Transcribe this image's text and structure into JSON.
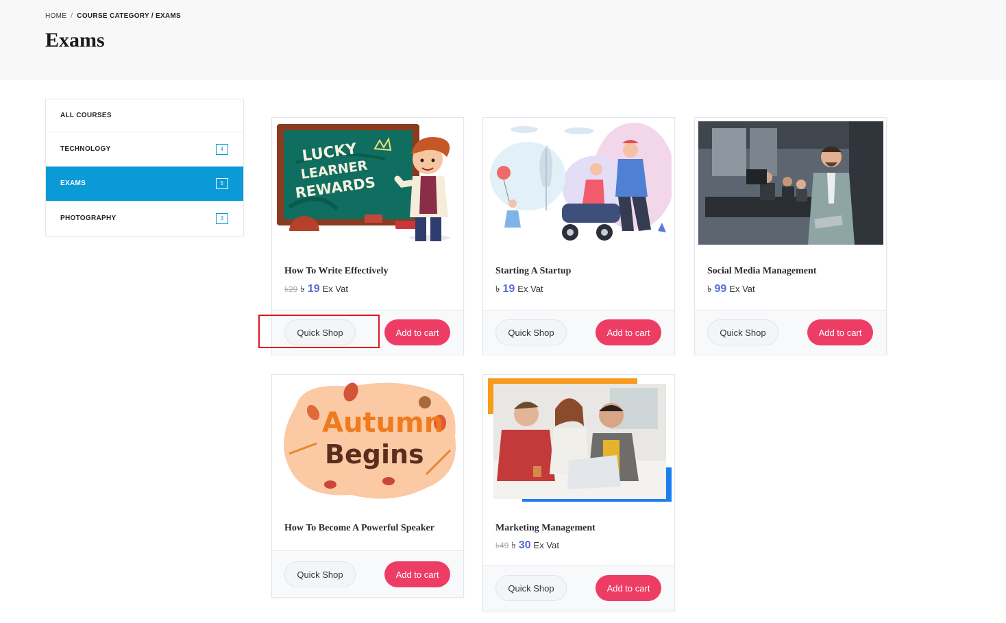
{
  "breadcrumb": {
    "home": "HOME",
    "separator": "/",
    "current": "COURSE CATEGORY / EXAMS"
  },
  "page_title": "Exams",
  "sidebar": {
    "items": [
      {
        "label": "ALL COURSES",
        "count": ""
      },
      {
        "label": "TECHNOLOGY",
        "count": "4"
      },
      {
        "label": "EXAMS",
        "count": "5"
      },
      {
        "label": "PHOTOGRAPHY",
        "count": "3"
      }
    ]
  },
  "currency": "৳",
  "ex_vat": "Ex Vat",
  "buttons": {
    "quick_shop": "Quick Shop",
    "add_to_cart": "Add to cart"
  },
  "courses": [
    {
      "title": "How To Write Effectively",
      "old_price": "29",
      "price": "19",
      "image_text": [
        "LUCKY",
        "LEARNER",
        "REWARDS"
      ]
    },
    {
      "title": "Starting A Startup",
      "old_price": "",
      "price": "19"
    },
    {
      "title": "Social Media Management",
      "old_price": "",
      "price": "99"
    },
    {
      "title": "How To Become A Powerful Speaker",
      "old_price": "",
      "price": "",
      "image_text": [
        "Autumn",
        "Begins"
      ]
    },
    {
      "title": "Marketing Management",
      "old_price": "49",
      "price": "30"
    }
  ],
  "colors": {
    "accent": "#0a9ad7",
    "cart_button": "#ee3d65",
    "price": "#5a6bd8",
    "highlight": "#e0141c"
  },
  "active_sidebar_item": "EXAMS"
}
